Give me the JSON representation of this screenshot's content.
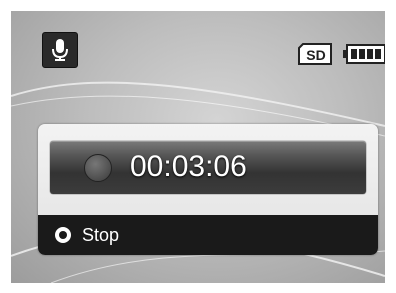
{
  "status_bar": {
    "mode_icon": "microphone-icon",
    "storage_label": "SD",
    "battery_level": 1.0
  },
  "recording": {
    "elapsed_time": "00:03:06",
    "status_icon": "record-dot-icon"
  },
  "footer": {
    "button_icon": "ok-button-icon",
    "action_label": "Stop"
  }
}
